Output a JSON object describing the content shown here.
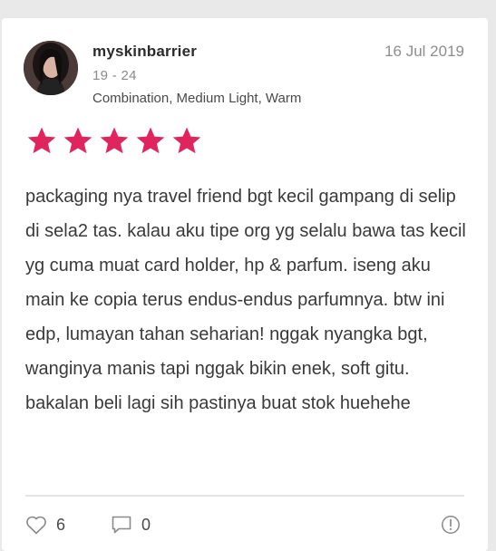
{
  "review": {
    "username": "myskinbarrier",
    "age_range": "19 - 24",
    "skin_profile": "Combination, Medium Light, Warm",
    "date": "16 Jul 2019",
    "rating": 5,
    "text": "packaging nya travel friend bgt kecil gampang di selip di sela2 tas. kalau aku tipe org yg selalu bawa tas kecil yg cuma muat card holder, hp & parfum. iseng aku main ke copia terus endus-endus parfumnya. btw ini edp, lumayan tahan seharian! nggak nyangka bgt, wanginya manis tapi nggak bikin enek, soft gitu. bakalan beli lagi sih pastinya buat stok huehehe"
  },
  "actions": {
    "likes": "6",
    "comments": "0",
    "like_icon": "heart-icon",
    "comment_icon": "comment-icon",
    "report_icon": "alert-circle-icon"
  },
  "colors": {
    "star": "#e0245e",
    "background": "#e9e9ea",
    "card": "#ffffff"
  }
}
